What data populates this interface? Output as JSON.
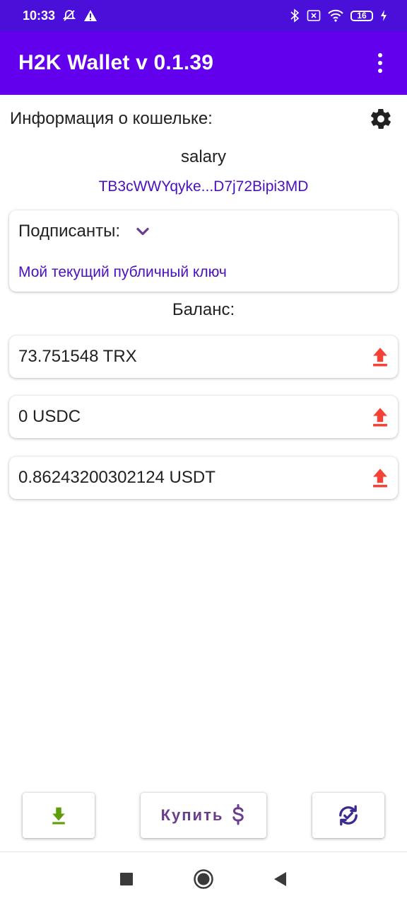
{
  "status_bar": {
    "time": "10:33",
    "battery": "16",
    "icons": [
      "mute-alarm-icon",
      "warning-icon",
      "bluetooth-icon",
      "sim-off-icon",
      "wifi-icon",
      "battery-icon",
      "charging-icon"
    ]
  },
  "app_bar": {
    "title": "H2K Wallet v 0.1.39",
    "menu_icon": "more-vert-icon"
  },
  "wallet_info": {
    "label": "Информация о кошельке:",
    "settings_icon": "gear-icon",
    "name": "salary",
    "address": "TB3cWWYqyke...D7j72Bipi3MD"
  },
  "signers": {
    "label": "Подписанты:",
    "expand_icon": "chevron-down-icon",
    "public_key_link": "Мой текущий публичный ключ"
  },
  "balance": {
    "label": "Баланс:",
    "items": [
      {
        "value": "73.751548 TRX",
        "action_icon": "send-upload-icon"
      },
      {
        "value": "0 USDC",
        "action_icon": "send-upload-icon"
      },
      {
        "value": "0.86243200302124 USDT",
        "action_icon": "send-upload-icon"
      }
    ]
  },
  "bottom_actions": {
    "receive_icon": "download-icon",
    "buy_label": "Купить",
    "buy_icon": "dollar-icon",
    "sync_icon": "sync-check-icon"
  },
  "colors": {
    "status_bar": "#4a0fd9",
    "app_bar": "#6200ee",
    "link": "#4a0fbf",
    "send": "#f44336",
    "download": "#5f9e0b",
    "accent": "#6a3d8e"
  },
  "nav_bar": {
    "icons": [
      "recents-square-icon",
      "home-circle-icon",
      "back-triangle-icon"
    ]
  }
}
